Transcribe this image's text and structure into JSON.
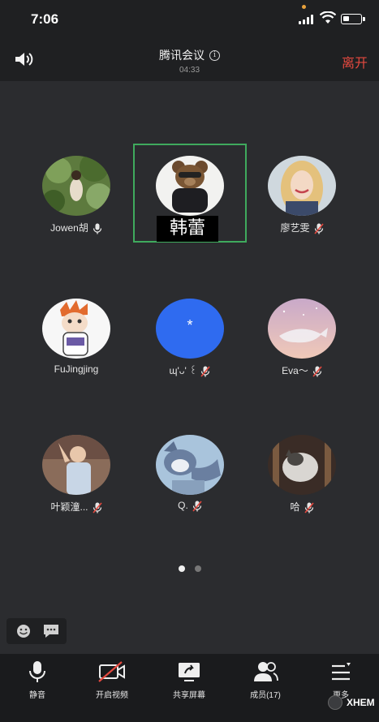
{
  "status_bar": {
    "time": "7:06"
  },
  "header": {
    "meeting_title": "腾讯会议",
    "timer": "04:33",
    "leave_label": "离开"
  },
  "active_speaker": {
    "caption": "韩蕾"
  },
  "participants": [
    {
      "name": "Jowen胡",
      "mic": "on",
      "avatar": "photo-green"
    },
    {
      "name": "",
      "mic": "none",
      "avatar": "bear-doll"
    },
    {
      "name": "廖艺雯",
      "mic": "muted",
      "avatar": "photo-blonde"
    },
    {
      "name": "FuJingjing",
      "mic": "none",
      "avatar": "cartoon-character"
    },
    {
      "name": "ɰ'ᴗ' ꒰",
      "mic": "muted",
      "avatar": "blue-star",
      "avatar_text": "*"
    },
    {
      "name": "Eva～",
      "mic": "muted",
      "avatar": "whale-sky"
    },
    {
      "name": "叶颖潼...",
      "mic": "muted",
      "avatar": "photo-man"
    },
    {
      "name": "Q.",
      "mic": "muted",
      "avatar": "cartoon-cat"
    },
    {
      "name": "哈",
      "mic": "muted",
      "avatar": "photo-cat"
    }
  ],
  "pager": {
    "pages": 2,
    "current": 1
  },
  "toolbar": {
    "items": [
      {
        "label": "静音",
        "icon": "microphone-icon"
      },
      {
        "label": "开启视频",
        "icon": "video-off-icon"
      },
      {
        "label": "共享屏幕",
        "icon": "share-screen-icon"
      },
      {
        "label": "成员(17)",
        "icon": "members-icon"
      },
      {
        "label": "更多",
        "icon": "more-menu-icon"
      }
    ]
  },
  "watermark": {
    "text": "XHEM"
  },
  "colors": {
    "background": "#2b2c2f",
    "active_border": "#3faa5d",
    "leave": "#e5493f",
    "avatar_blue": "#2f6bf0"
  }
}
